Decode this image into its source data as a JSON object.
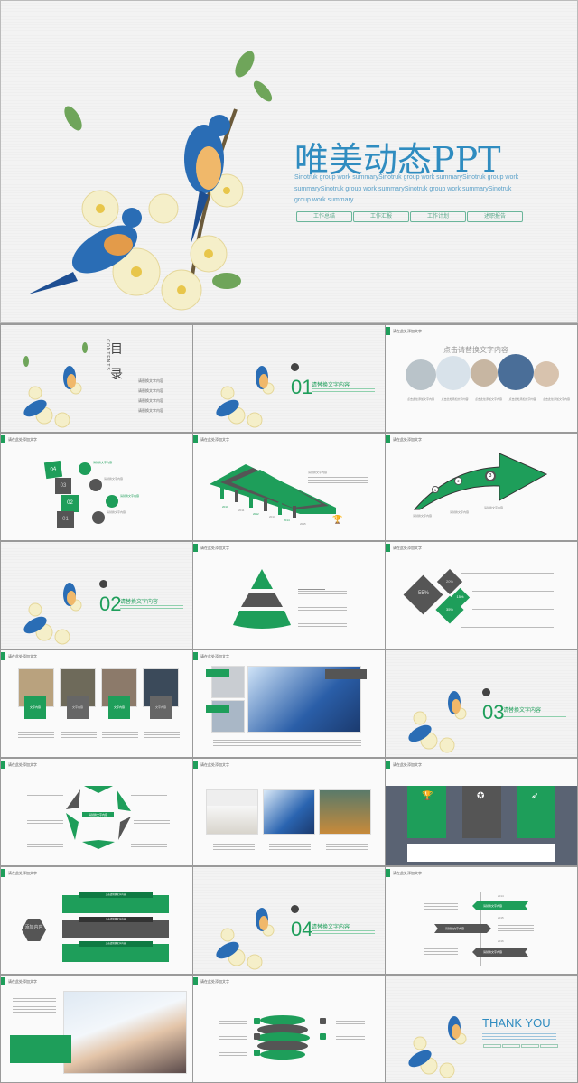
{
  "colors": {
    "accent": "#1e9e5a",
    "dark": "#555555",
    "title_blue": "#2f8cc0",
    "panel_bg": "#5a6373"
  },
  "cover": {
    "title": "唯美动态PPT",
    "subtitle": "Sinotruk group work summarySinotruk group work summarySinotruk group work summarySinotruk group work summarySinotruk group work summarySinotruk group work summary",
    "buttons": [
      "工作总结",
      "工作汇报",
      "工作计划",
      "述职报告"
    ]
  },
  "slide_header": "请在此处添加文字",
  "contents": {
    "title_1": "目",
    "title_2": "录",
    "en": "CONTENTS",
    "items": [
      "请替换文字内容",
      "请替换文字内容",
      "请替换文字内容",
      "请替换文字内容"
    ]
  },
  "sections": [
    {
      "num": "01",
      "title": "请替换文字内容"
    },
    {
      "num": "02",
      "title": "请替换文字内容"
    },
    {
      "num": "03",
      "title": "请替换文字内容"
    },
    {
      "num": "04",
      "title": "请替换文字内容"
    }
  ],
  "circles_slide": {
    "title": "点击请替换文字内容",
    "caption": "点击此处添加文字内容"
  },
  "steps_slide": {
    "steps": [
      "04",
      "03",
      "02",
      "01"
    ],
    "caption": "请替换文字内容"
  },
  "arrows_slide": {
    "years": [
      "2010",
      "2011",
      "2012",
      "2013",
      "2014",
      "2015"
    ],
    "caption": "请替换文字内容"
  },
  "curve_slide": {
    "markers": [
      "1",
      "2",
      "3"
    ],
    "caption": "请替换文字内容"
  },
  "diamond_slide": {
    "values": [
      "55%",
      "20%",
      "15%",
      "35%"
    ]
  },
  "photo_slide": {
    "labels": [
      "文字内容",
      "文字内容",
      "文字内容",
      "文字内容"
    ]
  },
  "star_slide": {
    "center": "请替换文字内容"
  },
  "hex_slide": {
    "hex": "添加内容",
    "bars": [
      "点击请替换文字内容",
      "点击请替换文字内容",
      "点击请替换文字内容"
    ]
  },
  "timeline_slide": {
    "years": [
      "2014",
      "2015",
      "2016"
    ],
    "labels": [
      "请替换文字内容",
      "请替换文字内容",
      "请替换文字内容"
    ]
  },
  "thanks": {
    "title": "THANK YOU"
  }
}
